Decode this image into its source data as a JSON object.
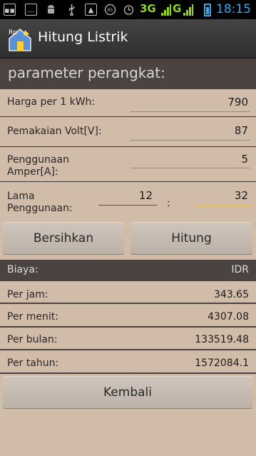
{
  "status_bar": {
    "network": "3G",
    "network2": "G",
    "time": "18:15"
  },
  "app": {
    "title": "Hitung Listrik"
  },
  "section": {
    "title": "parameter perangkat:"
  },
  "fields": {
    "harga_label": "Harga per 1 kWh:",
    "harga_value": "790",
    "volt_label": "Pemakaian Volt[V]:",
    "volt_value": "87",
    "amper_label_1": "Penggunaan",
    "amper_label_2": "Amper[A]:",
    "amper_value": "5",
    "lama_label_1": "Lama",
    "lama_label_2": "Penggunaan:",
    "lama_hours": "12",
    "lama_separator": ":",
    "lama_minutes": "32"
  },
  "buttons": {
    "clear": "Bersihkan",
    "calculate": "Hitung",
    "back": "Kembali"
  },
  "results": {
    "header_label": "Biaya:",
    "currency": "IDR",
    "rows": [
      {
        "label": "Per jam:",
        "value": "343.65"
      },
      {
        "label": "Per menit:",
        "value": "4307.08"
      },
      {
        "label": "Per bulan:",
        "value": "133519.48"
      },
      {
        "label": "Per tahun:",
        "value": "1572084.1"
      }
    ]
  },
  "colors": {
    "background": "#d0bca9",
    "header": "#4a4340",
    "accent_clock": "#3aa8e6",
    "signal": "#8fd61d"
  }
}
